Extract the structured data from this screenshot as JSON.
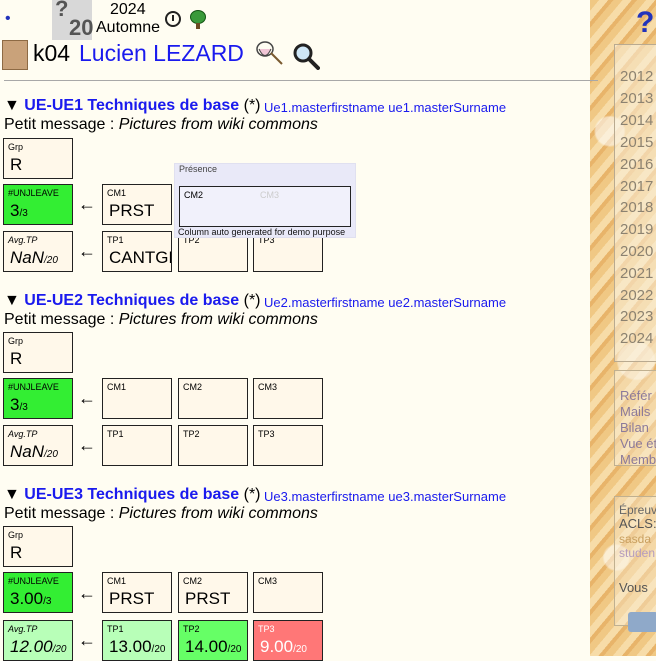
{
  "header": {
    "dot": "•",
    "grade_logo": {
      "num": "?",
      "den": "20"
    },
    "year": "2024",
    "semester": "Automne",
    "student_id": "k04",
    "student_name": "Lucien LEZARD"
  },
  "sidebar": {
    "help": "?",
    "years": [
      "2012",
      "2013",
      "2014",
      "2015",
      "2016",
      "2017",
      "2018",
      "2019",
      "2020",
      "2021",
      "2022",
      "2023",
      "2024"
    ],
    "links": [
      "Référ",
      "Mails",
      "Bilan",
      "Vue ét",
      "Memb"
    ],
    "epreuve": [
      "Épreuv",
      "ACLS:",
      "sasda",
      "studen"
    ],
    "vous": "Vous"
  },
  "ues": [
    {
      "title": "UE-UE1 Techniques de base",
      "star": "(*)",
      "master": "Ue1.masterfirstname ue1.masterSurname",
      "message_label": "Petit message : ",
      "message": "Pictures from wiki commons",
      "grp": {
        "label": "Grp",
        "value": "R"
      },
      "leave": {
        "label": "#UNJLEAVE",
        "value": "3",
        "sub": "/3"
      },
      "cm": [
        {
          "label": "CM1",
          "value": "PRST"
        },
        {
          "label": "CM2",
          "value": ""
        },
        {
          "label": "CM3",
          "value": ""
        }
      ],
      "avg": {
        "label": "Avg.TP",
        "value": "NaN",
        "sub": "/20"
      },
      "tp": [
        {
          "label": "TP1",
          "value": "CANTGRAB"
        },
        {
          "label": "TP2",
          "value": ""
        },
        {
          "label": "TP3",
          "value": ""
        }
      ]
    },
    {
      "title": "UE-UE2 Techniques de base",
      "star": "(*)",
      "master": "Ue2.masterfirstname ue2.masterSurname",
      "message_label": "Petit message : ",
      "message": "Pictures from wiki commons",
      "grp": {
        "label": "Grp",
        "value": "R"
      },
      "leave": {
        "label": "#UNJLEAVE",
        "value": "3",
        "sub": "/3"
      },
      "cm": [
        {
          "label": "CM1",
          "value": ""
        },
        {
          "label": "CM2",
          "value": ""
        },
        {
          "label": "CM3",
          "value": ""
        }
      ],
      "avg": {
        "label": "Avg.TP",
        "value": "NaN",
        "sub": "/20"
      },
      "tp": [
        {
          "label": "TP1",
          "value": ""
        },
        {
          "label": "TP2",
          "value": ""
        },
        {
          "label": "TP3",
          "value": ""
        }
      ]
    },
    {
      "title": "UE-UE3 Techniques de base",
      "star": "(*)",
      "master": "Ue3.masterfirstname ue3.masterSurname",
      "message_label": "Petit message : ",
      "message": "Pictures from wiki commons",
      "grp": {
        "label": "Grp",
        "value": "R"
      },
      "leave": {
        "label": "#UNJLEAVE",
        "value": "3.00",
        "sub": "/3"
      },
      "cm": [
        {
          "label": "CM1",
          "value": "PRST"
        },
        {
          "label": "CM2",
          "value": "PRST"
        },
        {
          "label": "CM3",
          "value": ""
        }
      ],
      "avg": {
        "label": "Avg.TP",
        "value": "12.00",
        "sub": "/20"
      },
      "tp": [
        {
          "label": "TP1",
          "value": "13.00",
          "sub": "/20"
        },
        {
          "label": "TP2",
          "value": "14.00",
          "sub": "/20"
        },
        {
          "label": "TP3",
          "value": "9.00",
          "sub": "/20"
        }
      ]
    }
  ],
  "column_popup": {
    "title": "Présence",
    "cm2_label": "CM2",
    "cm3_ghost": "CM3",
    "footer": "Column auto generated for demo purpose"
  },
  "arrow": "←",
  "colors": {
    "link": "#1a1aee",
    "green": "#33ee33",
    "red": "#ff7777",
    "cell": "#fff8ea"
  }
}
